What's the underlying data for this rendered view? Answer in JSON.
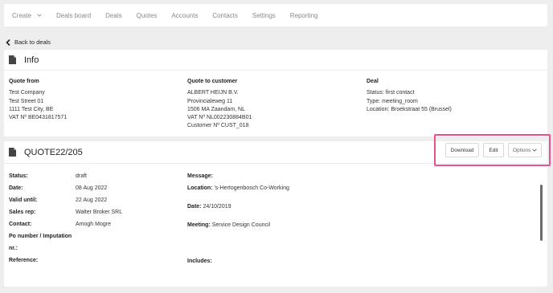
{
  "nav": {
    "items": [
      "Create",
      "Deals board",
      "Deals",
      "Quotes",
      "Accounts",
      "Contacts",
      "Settings",
      "Reporting"
    ]
  },
  "back_label": "Back to deals",
  "info": {
    "title": "Info",
    "quote_from": {
      "header": "Quote from",
      "lines": [
        "Test Company",
        "Test Street 01",
        "1111 Test City, BE",
        "VAT Nº BE0431817571"
      ]
    },
    "quote_to": {
      "header": "Quote to customer",
      "lines": [
        "ALBERT HEIJN B.V.",
        "Provincialeweg 11",
        "1506 MA Zaandam, NL",
        "VAT Nº NL002230884B01",
        "Customer Nº CUST_018"
      ]
    },
    "deal": {
      "header": "Deal",
      "lines": [
        "Status: first contact",
        "Type: meeting_room",
        "Location: Broekstraat 55 (Brussel)"
      ]
    }
  },
  "quote": {
    "title": "QUOTE22/205",
    "actions": {
      "download": "Download",
      "edit": "Edit",
      "options": "Options"
    },
    "fields": {
      "status_label": "Status:",
      "status_value": "draft",
      "date_label": "Date:",
      "date_value": "08 Aug 2022",
      "valid_label": "Valid until:",
      "valid_value": "22 Aug 2022",
      "rep_label": "Sales rep:",
      "rep_value": "Walter Broker SRL",
      "contact_label": "Contact:",
      "contact_value": "Amogh Mogre",
      "po_label_1": "Po number / Imputation",
      "po_label_2": "nr.:",
      "ref_label": "Reference:"
    },
    "right": {
      "message_label": "Message:",
      "location_label": "Location:",
      "location_value": "'s-Hertogenbosch Co-Working",
      "date_label": "Date:",
      "date_value": "24/10/2019",
      "meeting_label": "Meeting:",
      "meeting_value": "Service Design Council",
      "includes_label": "Includes:"
    }
  }
}
